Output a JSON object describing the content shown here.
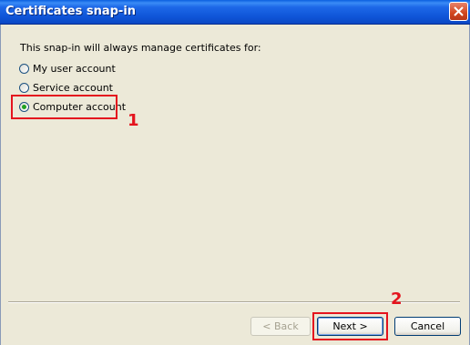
{
  "window": {
    "title": "Certificates snap-in"
  },
  "content": {
    "prompt": "This snap-in will always manage certificates for:",
    "options": [
      {
        "label": "My user account",
        "selected": false
      },
      {
        "label": "Service account",
        "selected": false
      },
      {
        "label": "Computer account",
        "selected": true
      }
    ]
  },
  "annotations": {
    "step1": "1",
    "step2": "2",
    "highlight_color": "#E4141E"
  },
  "buttons": {
    "back": "< Back",
    "next": "Next >",
    "cancel": "Cancel"
  },
  "icons": {
    "close": "close-icon"
  }
}
